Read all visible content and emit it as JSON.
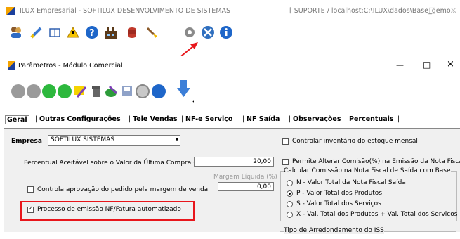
{
  "outer_window": {
    "title": "ILUX Empresarial - SOFTILUX DESENVOLVIMENTO DE SISTEMAS",
    "context": "[ SUPORTE / localhost:C:\\ILUX\\dados\\Base_demo...",
    "minimize": "—",
    "maximize": "□",
    "close": "×"
  },
  "outer_toolbar": {
    "icons": [
      "users-icon",
      "pencil-icon",
      "book-icon",
      "warning-icon",
      "help-icon",
      "factory-icon",
      "database-icon",
      "brush-icon",
      "gear-icon",
      "tools-icon",
      "info-icon"
    ]
  },
  "inner_window": {
    "title": "Parâmetros - Módulo Comercial",
    "minimize": "—",
    "maximize": "□",
    "close": "×"
  },
  "tabs": [
    "Geral",
    "Outras Configurações",
    "Tele Vendas",
    "NF-e Serviço",
    "NF Saída",
    "Observações",
    "Percentuais"
  ],
  "form": {
    "empresa_label": "Empresa",
    "empresa_value": "SOFTILUX SISTEMAS",
    "percentual_label": "Percentual Aceitável sobre o Valor da Última Compra (+/-)",
    "percentual_value": "20,00",
    "margem_label": "Margem Líquida (%)",
    "margem_value": "0,00",
    "controla_label": "Controla aprovação do pedido pela margem de venda",
    "processo_label": "Processo de emissão NF/Fatura automatizado",
    "inventario_label": "Controlar inventário do estoque mensal",
    "permite_label": "Permite Alterar Comisão(%) na Emissão da Nota Fiscal",
    "calc_group_label": "Calcular Comissão na Nota Fiscal de Saída com Base",
    "calc_options": [
      "N - Valor Total da Nota Fiscal Saída",
      "P - Valor Total dos Produtos",
      "S - Valor Total dos Serviços",
      "X - Val. Total dos Produtos + Val. Total dos Serviços"
    ],
    "arred_group_label": "Tipo de Arredondamento do ISS"
  },
  "colors": {
    "highlight": "#e8161c",
    "arrow": "#e8161c"
  }
}
